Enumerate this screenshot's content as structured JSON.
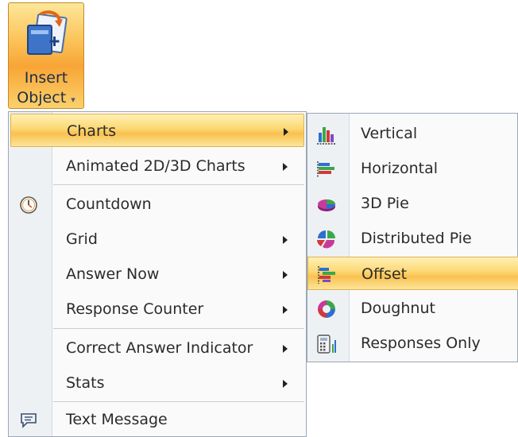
{
  "ribbon": {
    "button_line1": "Insert",
    "button_line2": "Object",
    "caret": "▾",
    "icon": "insert-object-icon"
  },
  "menu": {
    "items": [
      {
        "label": "Charts",
        "submenu": true,
        "highlighted": true
      },
      {
        "label": "Animated 2D/3D Charts",
        "submenu": true
      },
      {
        "label": "Countdown",
        "submenu": false,
        "icon": "clock-icon"
      },
      {
        "label": "Grid",
        "submenu": true
      },
      {
        "label": "Answer Now",
        "submenu": true
      },
      {
        "label": "Response Counter",
        "submenu": true
      },
      {
        "label": "Correct Answer Indicator",
        "submenu": true
      },
      {
        "label": "Stats",
        "submenu": true
      },
      {
        "label": "Text Message",
        "submenu": false,
        "icon": "text-message-icon"
      }
    ]
  },
  "submenu": {
    "items": [
      {
        "label": "Vertical",
        "icon": "vertical-bar-chart-icon"
      },
      {
        "label": "Horizontal",
        "icon": "horizontal-bar-chart-icon"
      },
      {
        "label": "3D Pie",
        "icon": "3d-pie-chart-icon"
      },
      {
        "label": "Distributed Pie",
        "icon": "distributed-pie-chart-icon"
      },
      {
        "label": "Offset",
        "icon": "offset-chart-icon",
        "highlighted": true
      },
      {
        "label": "Doughnut",
        "icon": "doughnut-chart-icon"
      },
      {
        "label": "Responses Only",
        "icon": "responses-only-icon"
      }
    ]
  },
  "colors": {
    "highlight": "#f9c14f",
    "ribbon_orange": "#f8a536",
    "menu_border": "#9ba7b7"
  }
}
